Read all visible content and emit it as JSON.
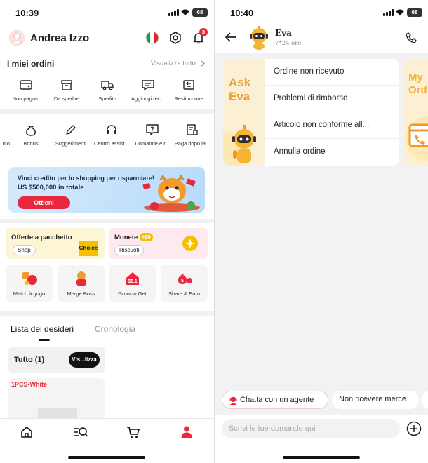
{
  "left": {
    "status_time": "10:39",
    "battery": "68",
    "user_name": "Andrea Izzo",
    "notif_count": "3",
    "orders_title": "I miei ordini",
    "view_all": "Visualizza tutto",
    "orders": [
      {
        "label": "Non pagato",
        "icon": "unpaid-icon"
      },
      {
        "label": "Da spedire",
        "icon": "box-icon"
      },
      {
        "label": "Spedito",
        "icon": "truck-icon"
      },
      {
        "label": "Aggiungi rec...",
        "icon": "review-icon"
      },
      {
        "label": "Restituzione",
        "icon": "return-icon"
      }
    ],
    "services": [
      {
        "label": "nto",
        "icon": "coupon-icon"
      },
      {
        "label": "Bonus",
        "icon": "moneybag-icon"
      },
      {
        "label": "Suggerimenti",
        "icon": "pencil-icon"
      },
      {
        "label": "Centro assist...",
        "icon": "headset-icon"
      },
      {
        "label": "Domande e r...",
        "icon": "question-icon"
      },
      {
        "label": "Paga dopo la...",
        "icon": "pay-later-icon"
      }
    ],
    "promo": {
      "line1": "Vinci credito per lo shopping per risparmiare!",
      "line2": "US $500,000 in totale",
      "button": "Ottieni"
    },
    "bundle": {
      "title": "Offerte a pacchetto",
      "button": "Shop",
      "badge": "Choice"
    },
    "coins": {
      "title": "Monete",
      "bonus": "+20",
      "button": "Riscuoti"
    },
    "games": [
      {
        "label": "Match à gogo"
      },
      {
        "label": "Merge Boss"
      },
      {
        "label": "Grow to Get"
      },
      {
        "label": "Share & Earn"
      }
    ],
    "tabs": {
      "wishlist": "Lista dei desideri",
      "history": "Cronologia"
    },
    "all_label": "Tutto (1)",
    "view_btn": "Vis...lizza",
    "product_text": "1PCS-White"
  },
  "right": {
    "status_time": "10:40",
    "battery": "68",
    "agent_name": "Eva",
    "agent_sub": "7*24 ore",
    "ask": "Ask",
    "eva": "Eva",
    "menu": [
      "Ordine non ricevuto",
      "Problemi di rimborso",
      "Articolo non conforme all...",
      "Annulla ordine"
    ],
    "next_card": {
      "line1": "My",
      "line2": "Ord"
    },
    "chip_agent": "Chatta con un agente",
    "chip_goods": "Non ricevere merce",
    "input_placeholder": "Scrivi le tue domande qui"
  },
  "colors": {
    "accent_red": "#e8283c",
    "choice_yellow": "#f5c000",
    "eva_orange": "#f19a2c",
    "promo_blue": "#cfe6fb"
  }
}
